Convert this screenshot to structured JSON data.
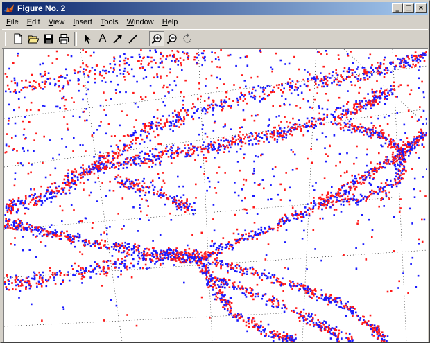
{
  "window": {
    "title": "Figure No. 2",
    "caption_buttons": [
      "_",
      "□",
      "×"
    ]
  },
  "menubar": {
    "items": [
      {
        "label": "File",
        "mnemonic": "F",
        "rest": "ile"
      },
      {
        "label": "Edit",
        "mnemonic": "E",
        "rest": "dit"
      },
      {
        "label": "View",
        "mnemonic": "V",
        "rest": "iew"
      },
      {
        "label": "Insert",
        "mnemonic": "I",
        "rest": "nsert"
      },
      {
        "label": "Tools",
        "mnemonic": "T",
        "rest": "ools"
      },
      {
        "label": "Window",
        "mnemonic": "W",
        "rest": "indow"
      },
      {
        "label": "Help",
        "mnemonic": "H",
        "rest": "elp"
      }
    ]
  },
  "toolbar": {
    "buttons": [
      {
        "name": "new-figure-icon"
      },
      {
        "name": "open-file-icon"
      },
      {
        "name": "save-icon"
      },
      {
        "name": "print-icon"
      },
      {
        "name": "edit-plot-arrow-icon"
      },
      {
        "name": "insert-text-icon"
      },
      {
        "name": "insert-arrow-icon"
      },
      {
        "name": "insert-line-icon"
      },
      {
        "name": "zoom-in-icon"
      },
      {
        "name": "zoom-out-icon"
      },
      {
        "name": "rotate-3d-icon"
      }
    ],
    "text_tool_glyph": "A"
  },
  "plot": {
    "type": "3d-scatter",
    "series_colors": [
      "#1a1aff",
      "#ff1a1a"
    ],
    "grid": true,
    "marker": "."
  }
}
